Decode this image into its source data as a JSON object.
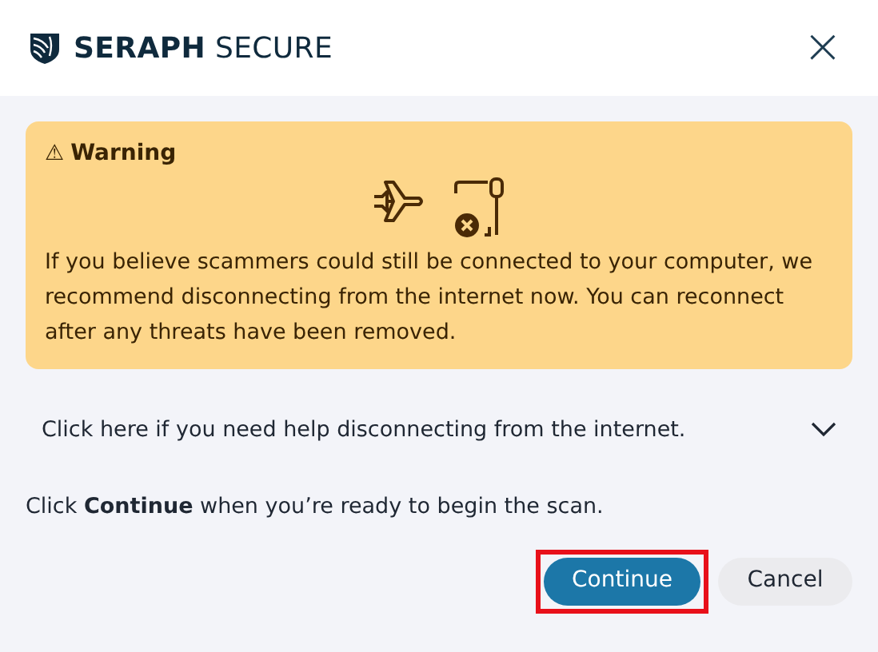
{
  "header": {
    "brand_bold": "SERAPH",
    "brand_light": "SECURE",
    "close": "×"
  },
  "warning": {
    "icon": "⚠",
    "title": "Warning",
    "message": "If you believe scammers could still be connected to your computer, we recommend disconnecting from the internet now. You can reconnect after any threats have been removed."
  },
  "help": {
    "text": "Click here if you need help disconnecting from the internet.",
    "expanded": false
  },
  "instruction": "Click **Continue** when you’re ready to begin the scan.",
  "buttons": [
    {
      "label": "Continue",
      "kind": "primary",
      "highlighted": true
    },
    {
      "label": "Cancel",
      "kind": "secondary",
      "highlighted": false
    }
  ]
}
